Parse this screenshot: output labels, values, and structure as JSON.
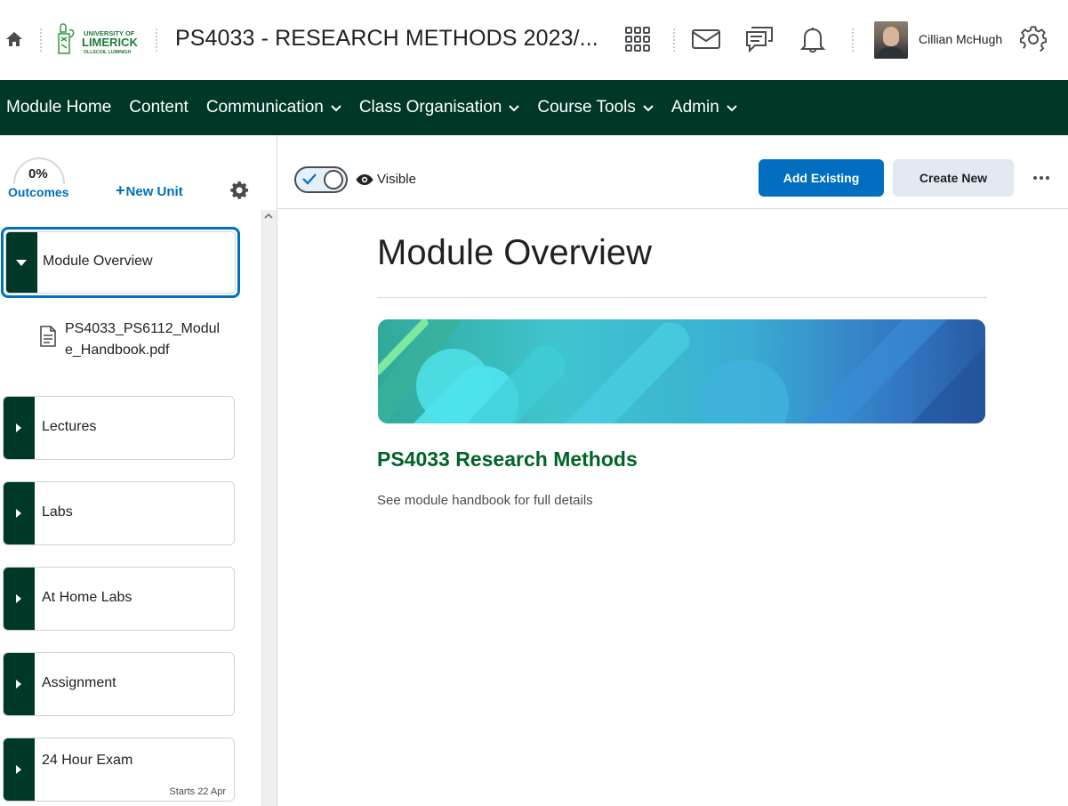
{
  "header": {
    "course_title": "PS4033 - RESEARCH METHODS 2023/...",
    "logo_text": [
      "UNIVERSITY OF",
      "LIMERICK",
      "OLLSCOIL LUIMNIGH"
    ],
    "user_name": "Cillian McHugh",
    "icons": [
      "home-icon",
      "apps-grid-icon",
      "mail-icon",
      "chat-icon",
      "bell-icon",
      "gear-icon"
    ]
  },
  "nav": {
    "items": [
      {
        "label": "Module Home",
        "dropdown": false
      },
      {
        "label": "Content",
        "dropdown": false
      },
      {
        "label": "Communication",
        "dropdown": true
      },
      {
        "label": "Class Organisation",
        "dropdown": true
      },
      {
        "label": "Course Tools",
        "dropdown": true
      },
      {
        "label": "Admin",
        "dropdown": true
      }
    ]
  },
  "sidebar": {
    "outcomes_percent": "0%",
    "outcomes_label": "Outcomes",
    "new_unit_label": "New Unit",
    "units": [
      {
        "label": "Module Overview",
        "expanded": true,
        "selected": true
      },
      {
        "label": "Lectures",
        "expanded": false
      },
      {
        "label": "Labs",
        "expanded": false
      },
      {
        "label": "At Home Labs",
        "expanded": false
      },
      {
        "label": "Assignment",
        "expanded": false
      },
      {
        "label": "24 Hour Exam",
        "expanded": false,
        "status": "Starts 22 Apr"
      }
    ],
    "file": {
      "name": "PS4033_PS6112_Module_Handbook.pdf",
      "icon": "document-icon"
    }
  },
  "toolbar": {
    "visibility_label": "Visible",
    "visibility_on": true,
    "add_existing_label": "Add Existing",
    "create_new_label": "Create New"
  },
  "content": {
    "title": "Module Overview",
    "heading": "PS4033 Research Methods",
    "text": "See module handbook for full details"
  },
  "colors": {
    "nav_bg": "#003828",
    "accent": "#006fbf",
    "heading_green": "#006428"
  }
}
